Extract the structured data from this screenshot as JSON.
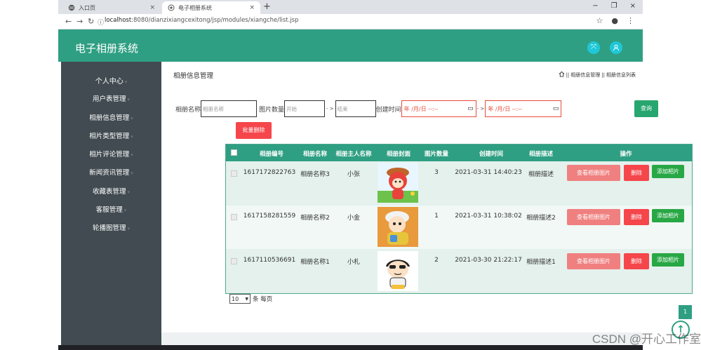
{
  "browser": {
    "tabs": [
      {
        "title": "入口页",
        "close": "×"
      },
      {
        "title": "电子相册系统",
        "close": "×"
      }
    ],
    "new_tab": "+",
    "window_controls": [
      "−",
      "❐",
      "×"
    ],
    "url_host": "localhost",
    "url_path": ":8080/dianzixiangcexitong/jsp/modules/xiangche/list.jsp"
  },
  "app": {
    "title": "电子相册系统"
  },
  "sidebar": {
    "items": [
      {
        "label": "个人中心"
      },
      {
        "label": "用户表管理"
      },
      {
        "label": "相册信息管理"
      },
      {
        "label": "相片类型管理"
      },
      {
        "label": "相片评论管理"
      },
      {
        "label": "新闻资讯管理"
      },
      {
        "label": "收藏表管理"
      },
      {
        "label": "客服管理"
      },
      {
        "label": "轮播图管理"
      }
    ]
  },
  "page": {
    "title": "相册信息管理",
    "breadcrumb": [
      "相册信息管理",
      "相册信息列表"
    ],
    "breadcrumb_sep": "||"
  },
  "filters": {
    "name_label": "相册名称",
    "name_placeholder": "相册名称",
    "count_label": "图片数量",
    "count_start": "开始",
    "count_end": "结束",
    "range_sep": "- >",
    "time_label": "创建时间",
    "date_placeholder": "年 /月/日 --:--",
    "search_button": "查询",
    "batch_delete_button": "批量删除"
  },
  "table": {
    "headers": [
      "相册编号",
      "相册名称",
      "相册主人名称",
      "相册封面",
      "图片数量",
      "创建时间",
      "相册描述",
      "操作"
    ],
    "rows": [
      {
        "id": "1617172822763",
        "name": "相册名称3",
        "owner": "小张",
        "count": "3",
        "created": "2021-03-31 14:40:23",
        "desc": "相册描述"
      },
      {
        "id": "1617158281559",
        "name": "相册名称2",
        "owner": "小金",
        "count": "1",
        "created": "2021-03-31 10:38:02",
        "desc": "相册描述2"
      },
      {
        "id": "1617110536691",
        "name": "相册名称1",
        "owner": "小札",
        "count": "2",
        "created": "2021-03-30 21:22:17",
        "desc": "相册描述1"
      }
    ],
    "action_view": "查看相册图片",
    "action_delete": "删除",
    "action_add": "添加相片"
  },
  "pager": {
    "page_size": "10",
    "suffix": "条 每页",
    "current_page": "1"
  },
  "watermark": "CSDN @开心工作室",
  "colors": {
    "primary": "#2f9f83",
    "sidebar": "#414b51",
    "danger": "#f5464b",
    "view": "#f08080",
    "success": "#28a745"
  }
}
